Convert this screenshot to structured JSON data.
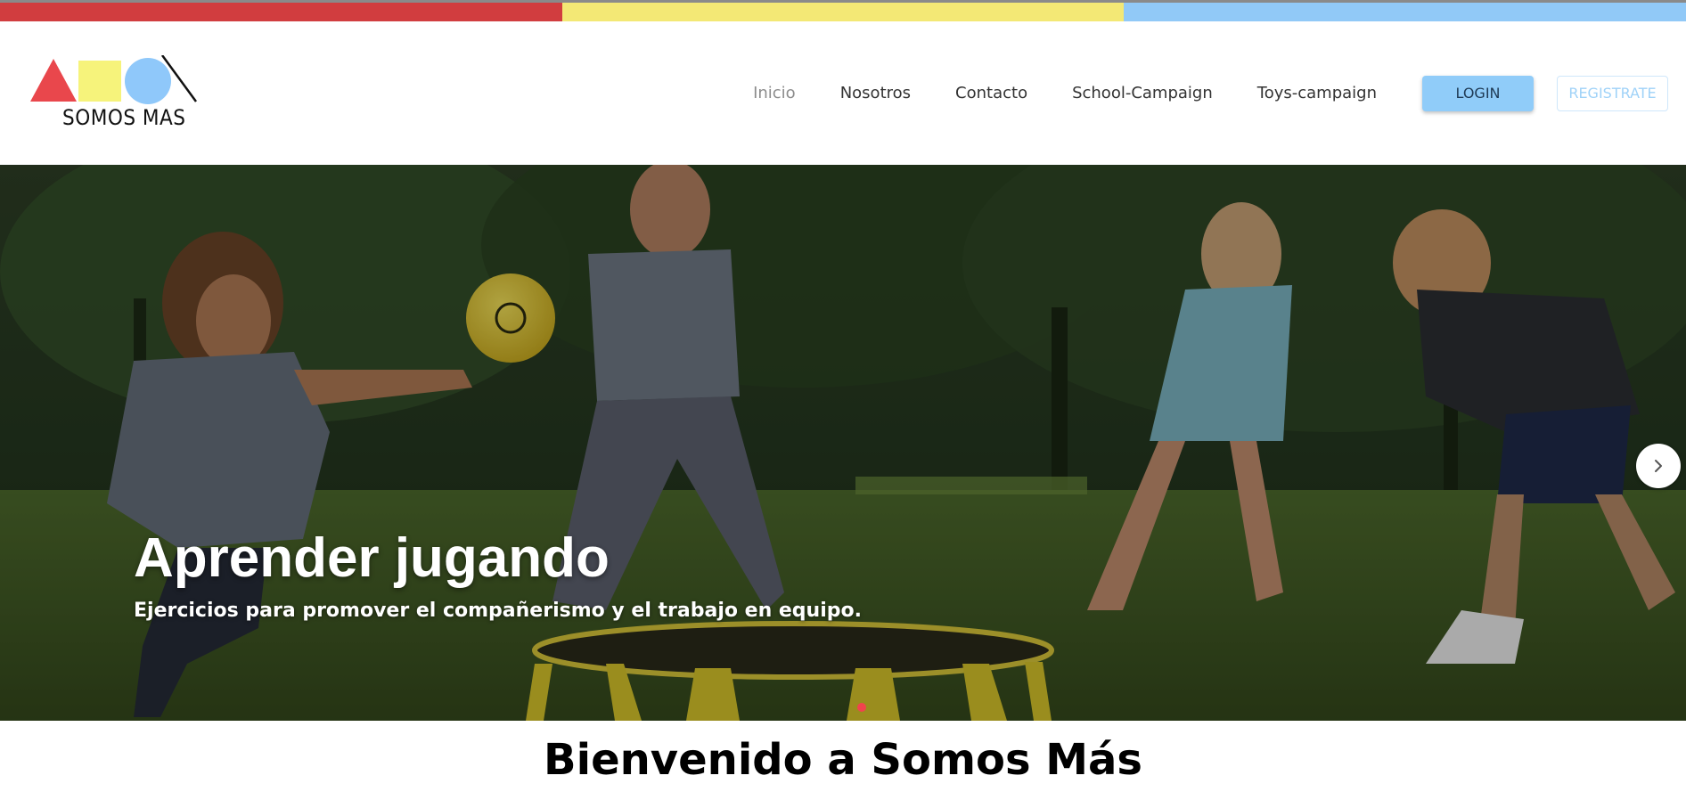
{
  "brand": {
    "logo_text": "SOMOS MAS",
    "colors": {
      "red": "#d13d3f",
      "yellow": "#f3e875",
      "blue": "#91c9f7",
      "logo_triangle": "#e9474c",
      "logo_square": "#f6f37b",
      "logo_circle": "#8fc8fa"
    }
  },
  "nav": {
    "items": [
      {
        "label": "Inicio",
        "active": true
      },
      {
        "label": "Nosotros",
        "active": false
      },
      {
        "label": "Contacto",
        "active": false
      },
      {
        "label": "School-Campaign",
        "active": false
      },
      {
        "label": "Toys-campaign",
        "active": false
      }
    ],
    "login_label": "LOGIN",
    "register_label": "REGISTRATE"
  },
  "hero": {
    "slide_title": "Aprender jugando",
    "slide_subtitle": "Ejercicios para promover el compañerismo y el trabajo en equipo.",
    "next_icon": "chevron-right-icon",
    "dot_color": "#f1434d"
  },
  "welcome": {
    "heading": "Bienvenido a Somos Más"
  }
}
